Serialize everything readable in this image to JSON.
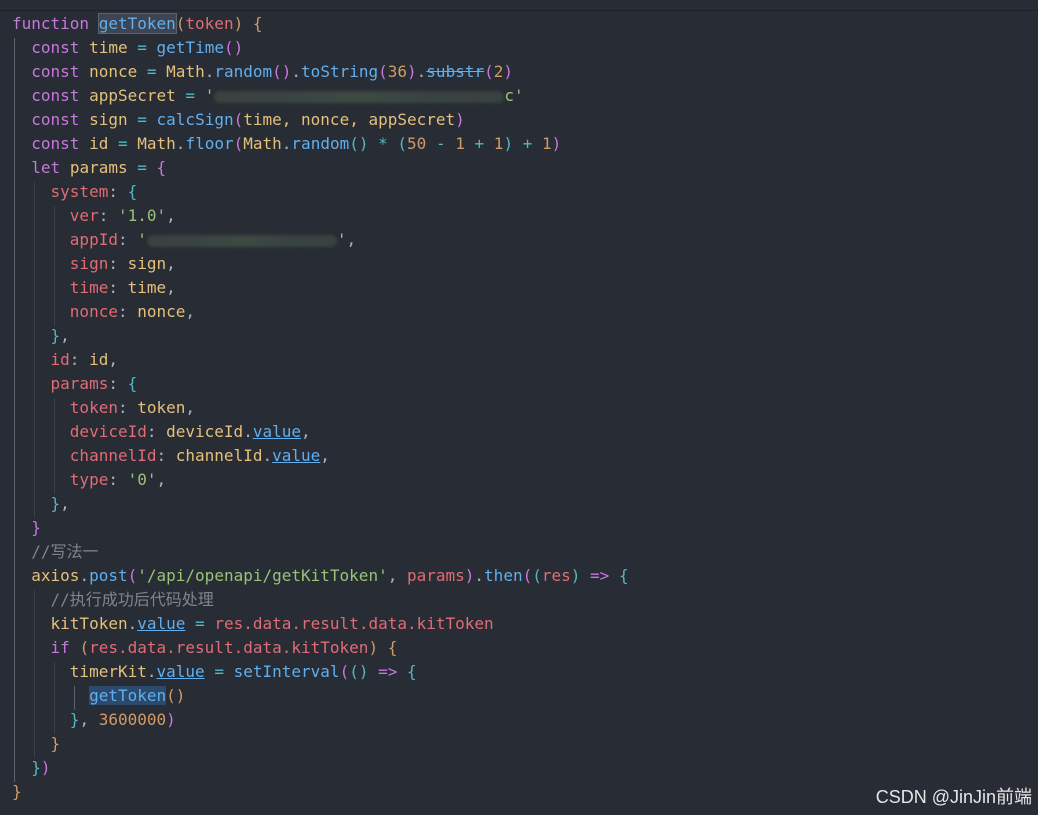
{
  "code": {
    "l1": {
      "kw": "function",
      "name": "getToken",
      "param": "token"
    },
    "l2": {
      "kw": "const",
      "var": "time",
      "fn": "getTime"
    },
    "l3": {
      "kw": "const",
      "var": "nonce",
      "obj": "Math",
      "m1": "random",
      "m2": "toString",
      "n1": "36",
      "m3": "substr",
      "n2": "2"
    },
    "l4": {
      "kw": "const",
      "var": "appSecret",
      "str_start": "'",
      "str_end": "c'"
    },
    "l5": {
      "kw": "const",
      "var": "sign",
      "fn": "calcSign",
      "args": "time, nonce, appSecret"
    },
    "l6": {
      "kw": "const",
      "var": "id",
      "obj": "Math",
      "m1": "floor",
      "m2": "random",
      "n1": "50",
      "n2": "1",
      "n3": "1",
      "n4": "1"
    },
    "l7": {
      "kw": "let",
      "var": "params"
    },
    "l8": {
      "prop": "system"
    },
    "l9": {
      "prop": "ver",
      "val": "'1.0'"
    },
    "l10": {
      "prop": "appId",
      "str_start": "'",
      "str_end": "'"
    },
    "l11": {
      "prop": "sign",
      "val": "sign"
    },
    "l12": {
      "prop": "time",
      "val": "time"
    },
    "l13": {
      "prop": "nonce",
      "val": "nonce"
    },
    "l15": {
      "prop": "id",
      "val": "id"
    },
    "l16": {
      "prop": "params"
    },
    "l17": {
      "prop": "token",
      "val": "token"
    },
    "l18": {
      "prop": "deviceId",
      "obj": "deviceId",
      "m": "value"
    },
    "l19": {
      "prop": "channelId",
      "obj": "channelId",
      "m": "value"
    },
    "l20": {
      "prop": "type",
      "val": "'0'"
    },
    "l23": {
      "comment": "//写法一"
    },
    "l24": {
      "obj": "axios",
      "m1": "post",
      "url": "'/api/openapi/getKitToken'",
      "arg": "params",
      "m2": "then",
      "p": "res"
    },
    "l25": {
      "comment": "//执行成功后代码处理"
    },
    "l26": {
      "obj": "kitToken",
      "m": "value",
      "chain": "res.data.result.data.kitToken"
    },
    "l27": {
      "kw": "if",
      "chain": "res.data.result.data.kitToken"
    },
    "l28": {
      "obj": "timerKit",
      "m": "value",
      "fn": "setInterval"
    },
    "l29": {
      "fn": "getToken"
    },
    "l30": {
      "num": "3600000"
    }
  },
  "watermark": "CSDN @JinJin前端"
}
